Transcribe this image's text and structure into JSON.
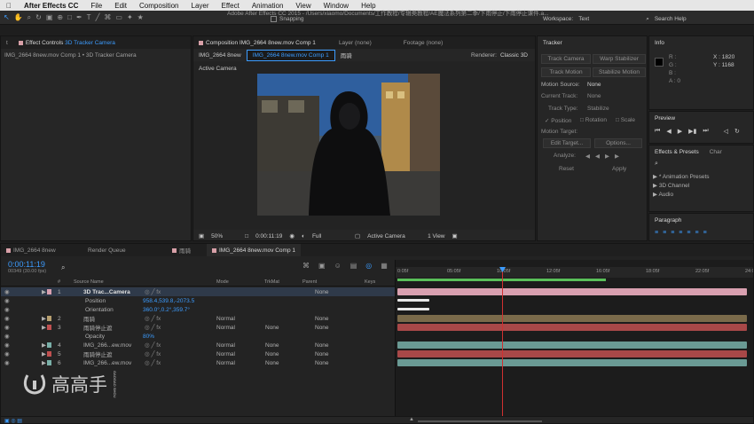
{
  "menubar": {
    "apple": "",
    "app": "After Effects CC",
    "items": [
      "File",
      "Edit",
      "Composition",
      "Layer",
      "Effect",
      "Animation",
      "View",
      "Window",
      "Help"
    ]
  },
  "titlebar": {
    "title": "Adobe After Effects CC 2015 - /Users/xiaomo/Documents/工作教程/专辑类教程/AE魔法系列第二季/下雨停止/下雨停止课件.a...",
    "snapping": "Snapping",
    "workspace_label": "Workspace:",
    "workspace_value": "Text",
    "search": "Search Help"
  },
  "effect_controls": {
    "tab": "Effect Controls",
    "tab_target": "3D Tracker Camera",
    "breadcrumb": "IMG_2664 8new.mov Comp 1 • 3D Tracker Camera"
  },
  "composition": {
    "tabs": [
      "Composition IMG_2664 8new.mov Comp 1",
      "Layer (none)",
      "Footage (none)"
    ],
    "subtabs": [
      "IMG_2664 8new",
      "IMG_2664 8new.mov Comp 1",
      "雨骑"
    ],
    "renderer_label": "Renderer:",
    "renderer_value": "Classic 3D",
    "active_camera": "Active Camera",
    "zoom": "50%",
    "timecode": "0:00:11:19",
    "resolution": "Full",
    "view": "Active Camera",
    "views": "1 View"
  },
  "tracker": {
    "title": "Tracker",
    "buttons": [
      "Track Camera",
      "Warp Stabilizer",
      "Track Motion",
      "Stabilize Motion"
    ],
    "motion_source_label": "Motion Source:",
    "motion_source": "None",
    "current_track_label": "Current Track:",
    "current_track": "None",
    "track_type_label": "Track Type:",
    "track_type": "Stabilize",
    "checks": [
      "Position",
      "Rotation",
      "Scale"
    ],
    "motion_target_label": "Motion Target:",
    "edit_target": "Edit Target...",
    "options": "Options...",
    "analyze": "Analyze:",
    "reset": "Reset",
    "apply": "Apply"
  },
  "info": {
    "title": "Info",
    "r": "R :",
    "g": "G :",
    "b": "B :",
    "a": "A : 0",
    "x": "X : 1820",
    "y": "Y : 1168"
  },
  "preview": {
    "title": "Preview"
  },
  "effects": {
    "title": "Effects & Presets",
    "tab2": "Char",
    "items": [
      "* Animation Presets",
      "3D Channel",
      "Audio"
    ]
  },
  "paragraph": {
    "title": "Paragraph"
  },
  "timeline": {
    "tabs": [
      "IMG_2664 8new",
      "Render Queue",
      "雨骑",
      "IMG_2664 8new.mov Comp 1"
    ],
    "timecode": "0:00:11:19",
    "fps": "00349 (30.00 fps)",
    "headers": {
      "num": "#",
      "source": "Source Name",
      "mode": "Mode",
      "trkmat": "TrkMat",
      "parent": "Parent",
      "keys": "Keys"
    },
    "ruler": [
      "0:05f",
      "05:05f",
      "10:05f",
      "12:05f",
      "16:05f",
      "18:05f",
      "22:05f",
      "24:05f"
    ],
    "layers": [
      {
        "num": "1",
        "name": "3D Trac...Camera",
        "mode": "",
        "trkmat": "",
        "parent": "None",
        "color": "#d9a0b0"
      },
      {
        "num": "",
        "name": "Position",
        "mode": "",
        "trkmat": "",
        "parent": "",
        "value": "958.4,539.8,-2073.5"
      },
      {
        "num": "",
        "name": "Orientation",
        "mode": "",
        "trkmat": "",
        "parent": "",
        "value": "360.0°,0.2°,359.7°"
      },
      {
        "num": "2",
        "name": "雨骑",
        "mode": "Normal",
        "trkmat": "",
        "parent": "None",
        "color": "#b8a070"
      },
      {
        "num": "3",
        "name": "雨骑停止遮",
        "mode": "Normal",
        "trkmat": "None",
        "parent": "None",
        "color": "#c05050"
      },
      {
        "num": "",
        "name": "Opacity",
        "mode": "",
        "trkmat": "",
        "parent": "",
        "value": "80%"
      },
      {
        "num": "4",
        "name": "IMG_266...ew.mov",
        "mode": "Normal",
        "trkmat": "None",
        "parent": "None",
        "color": "#7ab0a8"
      },
      {
        "num": "5",
        "name": "雨骑停止遮",
        "mode": "Normal",
        "trkmat": "None",
        "parent": "None",
        "color": "#c05050"
      },
      {
        "num": "6",
        "name": "IMG_266...ew.mov",
        "mode": "Normal",
        "trkmat": "None",
        "parent": "None",
        "color": "#7ab0a8"
      }
    ]
  },
  "watermark": {
    "text": "高高手",
    "small": "GAOGAO SHOU"
  },
  "colors": {
    "accent": "#3c9cff",
    "playhead": "#d03030",
    "timecode": "#3c9cff"
  }
}
